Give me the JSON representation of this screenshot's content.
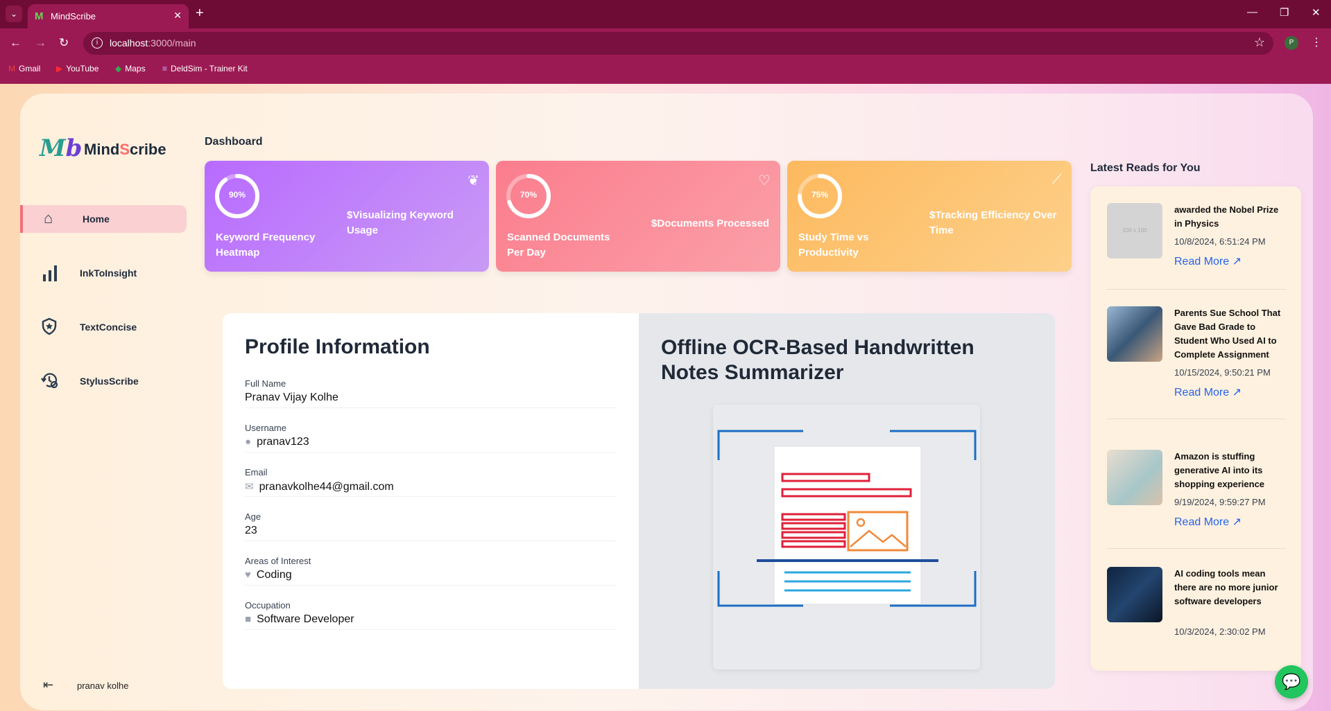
{
  "browser": {
    "tab_title": "MindScribe",
    "url_host": "localhost",
    "url_rest": ":3000/main",
    "profile_initial": "P",
    "bookmarks": [
      "Gmail",
      "YouTube",
      "Maps",
      "DeldSim - Trainer Kit"
    ]
  },
  "brand": {
    "logo": "M",
    "logo_b": "b",
    "name_a": "Mind",
    "name_s": "S",
    "name_b": "cribe"
  },
  "sidebar": {
    "items": [
      {
        "label": "Home",
        "icon": "home-icon"
      },
      {
        "label": "InkToInsight",
        "icon": "bar-chart-icon"
      },
      {
        "label": "TextConcise",
        "icon": "shield-icon"
      },
      {
        "label": "StylusScribe",
        "icon": "history-gear-icon"
      }
    ],
    "user": "pranav kolhe"
  },
  "dashboard": {
    "title": "Dashboard",
    "stats": [
      {
        "percent": "90%",
        "value": 0.9,
        "name": "Keyword Frequency Heatmap",
        "desc": "$Visualizing Keyword Usage",
        "icon": "sprout-icon",
        "color": "#c084fc"
      },
      {
        "percent": "70%",
        "value": 0.7,
        "name": "Scanned Documents Per Day",
        "desc": "$Documents Processed",
        "icon": "heart-pulse-icon",
        "color": "#fb8f9b"
      },
      {
        "percent": "75%",
        "value": 0.75,
        "name": "Study Time vs Productivity",
        "desc": "$Tracking Efficiency Over Time",
        "icon": "trend-icon",
        "color": "#fdc470"
      }
    ]
  },
  "profile": {
    "title": "Profile Information",
    "fields": [
      {
        "label": "Full Name",
        "value": "Pranav Vijay Kolhe",
        "icon": ""
      },
      {
        "label": "Username",
        "value": "pranav123",
        "icon": "user-icon"
      },
      {
        "label": "Email",
        "value": "pranavkolhe44@gmail.com",
        "icon": "mail-icon"
      },
      {
        "label": "Age",
        "value": "23",
        "icon": ""
      },
      {
        "label": "Areas of Interest",
        "value": "Coding",
        "icon": "heart-icon"
      },
      {
        "label": "Occupation",
        "value": "Software Developer",
        "icon": "briefcase-icon"
      }
    ]
  },
  "ocr": {
    "title": "Offline OCR-Based Handwritten Notes Summarizer"
  },
  "reads": {
    "title": "Latest Reads for You",
    "more_label": "Read More",
    "items": [
      {
        "title": "awarded the Nobel Prize in Physics",
        "date": "10/8/2024, 6:51:24 PM",
        "thumb": "100 x 100"
      },
      {
        "title": "Parents Sue School That Gave Bad Grade to Student Who Used AI to Complete Assignment",
        "date": "10/15/2024, 9:50:21 PM",
        "thumb": ""
      },
      {
        "title": "Amazon is stuffing generative AI into its shopping experience",
        "date": "9/19/2024, 9:59:27 PM",
        "thumb": ""
      },
      {
        "title": "AI coding tools mean there are no more junior software developers",
        "date": "10/3/2024, 2:30:02 PM",
        "thumb": ""
      }
    ]
  }
}
